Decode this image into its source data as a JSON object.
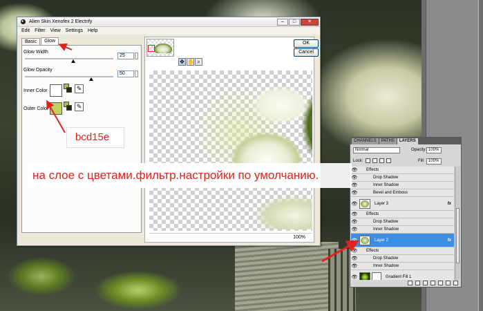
{
  "dialog": {
    "title": "Alien Skin Xenofex 2 Electrify",
    "menu": [
      "Edit",
      "Filter",
      "View",
      "Settings",
      "Help"
    ],
    "tabs": [
      "Basic",
      "Glow"
    ],
    "active_tab": "Glow",
    "glow_width": {
      "label": "Glow Width",
      "value": "25",
      "fraction": 0.55
    },
    "glow_opacity": {
      "label": "Glow Opacity",
      "value": "50",
      "fraction": 0.75
    },
    "inner_color": {
      "label": "Inner Color",
      "color": "#ffffff"
    },
    "outer_color": {
      "label": "Outer Color",
      "color": "#bcd15e"
    },
    "ok_label": "OK",
    "cancel_label": "Cancel",
    "zoom": "100%"
  },
  "annotations": {
    "color_note": "bcd15e",
    "banner": "на слое с цветами.фильтр.настройки по умолчанию."
  },
  "layers_panel": {
    "tabs": [
      "CHANNELS",
      "PATHS",
      "LAYERS"
    ],
    "active_tab": "LAYERS",
    "blend_mode": "Normal",
    "opacity_label": "Opacity:",
    "opacity": "100%",
    "lock_label": "Lock:",
    "fill_label": "Fill:",
    "fill": "100%",
    "rows": [
      {
        "type": "fx",
        "label": "Effects"
      },
      {
        "type": "sub",
        "label": "Drop Shadow"
      },
      {
        "type": "sub",
        "label": "Inner Shadow"
      },
      {
        "type": "sub",
        "label": "Bevel and Emboss"
      },
      {
        "type": "layer",
        "label": "Layer 3",
        "fx": "fx"
      },
      {
        "type": "fx",
        "label": "Effects"
      },
      {
        "type": "sub",
        "label": "Drop Shadow"
      },
      {
        "type": "sub",
        "label": "Inner Shadow"
      },
      {
        "type": "layer",
        "label": "Layer 2",
        "fx": "fx",
        "selected": true
      },
      {
        "type": "fx",
        "label": "Effects"
      },
      {
        "type": "sub",
        "label": "Drop Shadow"
      },
      {
        "type": "sub",
        "label": "Inner Shadow"
      },
      {
        "type": "fill",
        "label": "Gradient Fill 1"
      }
    ]
  },
  "colors": {
    "annotation": "#e0231d",
    "selection": "#3c8fe0"
  }
}
